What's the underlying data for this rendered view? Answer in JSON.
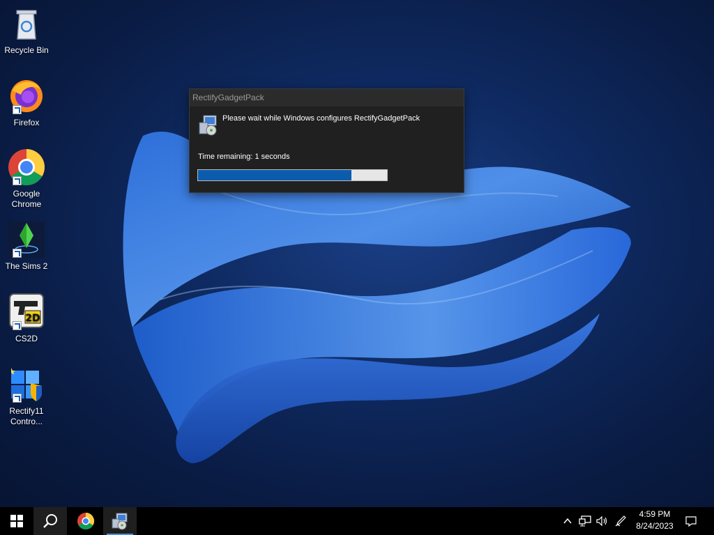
{
  "desktop_icons": [
    {
      "label": "Recycle Bin",
      "icon": "recycle-bin-icon"
    },
    {
      "label": "Firefox",
      "icon": "firefox-icon"
    },
    {
      "label": "Google Chrome",
      "icon": "chrome-icon"
    },
    {
      "label": "The Sims 2",
      "icon": "sims2-icon"
    },
    {
      "label": "CS2D",
      "icon": "cs2d-icon"
    },
    {
      "label": "Rectify11 Contro...",
      "icon": "rectify11-control-icon"
    }
  ],
  "dialog": {
    "title": "RectifyGadgetPack",
    "message": "Please wait while Windows configures RectifyGadgetPack",
    "time_remaining": "Time remaining: 1 seconds",
    "progress": 0.81
  },
  "taskbar": {
    "start": "windows-logo-icon",
    "search": "search-icon",
    "pinned": [
      "chrome-icon",
      "installer-icon"
    ],
    "tray_icons": [
      "chevron-up-icon",
      "network-icon",
      "volume-icon",
      "pen-icon"
    ],
    "time": "4:59 PM",
    "date": "8/24/2023",
    "notifications": "notification-icon"
  },
  "colors": {
    "accent": "#0b5cad",
    "taskbar": "#000000",
    "dialog_bg": "#202020"
  }
}
